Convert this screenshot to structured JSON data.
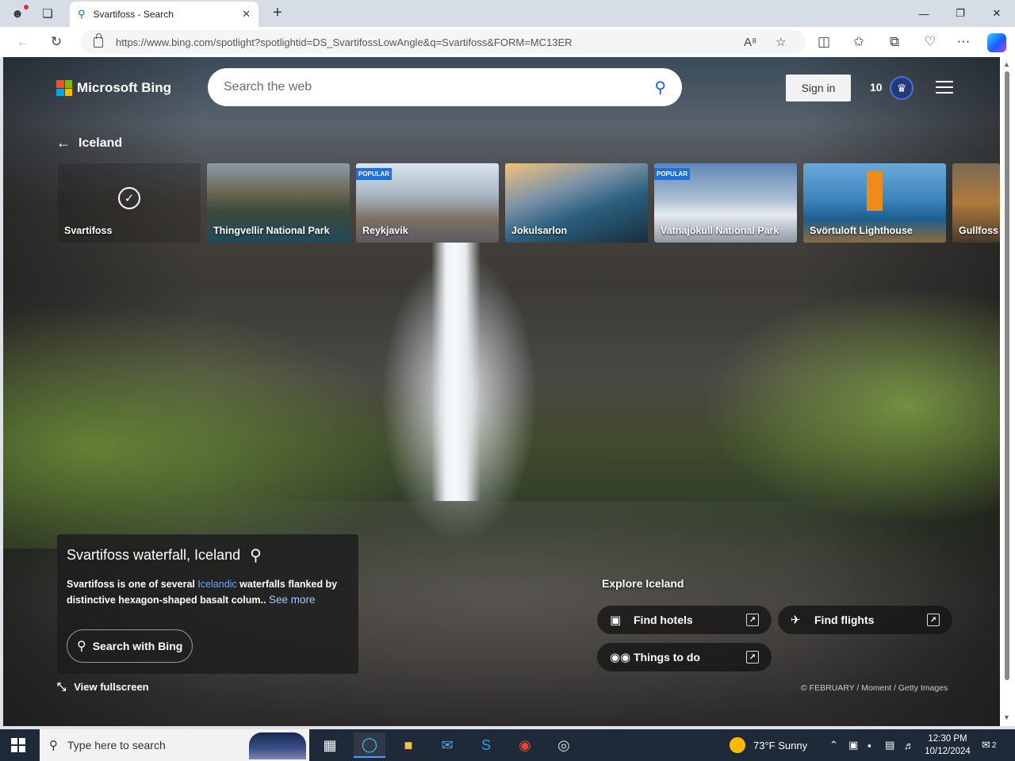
{
  "browser": {
    "tab_title": "Svartifoss - Search",
    "url": "https://www.bing.com/spotlight?spotlightid=DS_SvartifossLowAngle&q=Svartifoss&FORM=MC13ER"
  },
  "header": {
    "logo_text": "Microsoft Bing",
    "search_placeholder": "Search the web",
    "signin_label": "Sign in",
    "rewards_count": "10"
  },
  "nav": {
    "back_label": "Iceland"
  },
  "carousel": [
    {
      "label": "Svartifoss",
      "popular": false,
      "selected": true
    },
    {
      "label": "Thingvellir National Park",
      "popular": false
    },
    {
      "label": "Reykjavik",
      "popular": true
    },
    {
      "label": "Jokulsarlon",
      "popular": false
    },
    {
      "label": "Vatnajökull National Park",
      "popular": true
    },
    {
      "label": "Svörtuloft Lighthouse",
      "popular": false
    },
    {
      "label": "Gullfoss",
      "popular": false
    }
  ],
  "popular_badge": "POPULAR",
  "info": {
    "title": "Svartifoss waterfall, Iceland",
    "desc_pre": "Svartifoss is one of several ",
    "desc_link": "Icelandic",
    "desc_post": " waterfalls flanked by distinctive hexagon-shaped basalt colum..",
    "see_more": "See more",
    "search_button": "Search with Bing",
    "fullscreen": "View fullscreen"
  },
  "explore": {
    "title": "Explore Iceland",
    "hotels": "Find hotels",
    "flights": "Find flights",
    "things": "Things to do"
  },
  "credit": "© FEBRUARY / Moment / Getty Images",
  "taskbar": {
    "search_placeholder": "Type here to search",
    "weather": "73°F  Sunny",
    "time": "12:30 PM",
    "date": "10/12/2024",
    "notifications": "2"
  }
}
